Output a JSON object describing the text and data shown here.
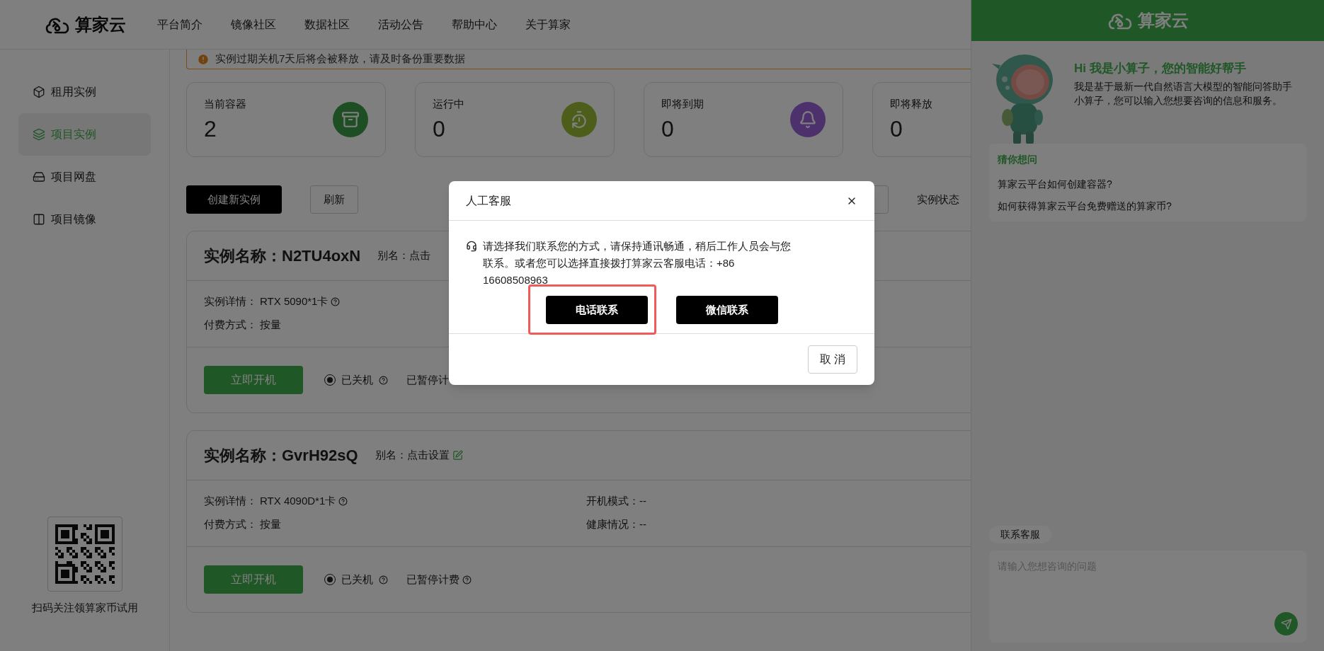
{
  "header": {
    "brand": "算家云",
    "nav": [
      {
        "label": "平台简介"
      },
      {
        "label": "镜像社区"
      },
      {
        "label": "数据社区"
      },
      {
        "label": "活动公告"
      },
      {
        "label": "帮助中心"
      },
      {
        "label": "关于算家"
      }
    ]
  },
  "sidebar": {
    "items": [
      {
        "label": "租用实例",
        "kind": "cube",
        "selected": false
      },
      {
        "label": "项目实例",
        "kind": "layers",
        "selected": true
      },
      {
        "label": "项目网盘",
        "kind": "disk",
        "selected": false
      },
      {
        "label": "项目镜像",
        "kind": "columns",
        "selected": false
      }
    ],
    "qr_caption": "扫码关注领算家币试用"
  },
  "notice": "实例过期关机7天后将会被释放，请及时备份重要数据",
  "stats": [
    {
      "label": "当前容器",
      "value": "2",
      "kind": "box"
    },
    {
      "label": "运行中",
      "value": "0",
      "kind": "timer"
    },
    {
      "label": "即将到期",
      "value": "0",
      "kind": "bell"
    },
    {
      "label": "即将释放",
      "value": "0",
      "kind": "none"
    }
  ],
  "toolbar": {
    "create_button": "创建新实例",
    "refresh_button": "刷新",
    "filter_label": "实例状态"
  },
  "instances": [
    {
      "title": "实例名称：N2TU4oxN",
      "alias": "别名：点击",
      "alias_edit": false,
      "details": [
        {
          "label": "实例详情：",
          "value": "RTX 5090*1卡",
          "help": true
        },
        {
          "label": "付费方式：",
          "value": "按量",
          "help": false
        }
      ],
      "start_button": "立即开机",
      "status": {
        "label": "已关机",
        "selected": true
      },
      "billing": "已暂停计",
      "billing_help": false
    },
    {
      "title": "实例名称：GvrH92sQ",
      "alias": "别名：点击设置",
      "alias_edit": true,
      "details": [
        {
          "label": "实例详情：",
          "value": "RTX 4090D*1卡",
          "help": true
        },
        {
          "label": "付费方式：",
          "value": "按量",
          "help": false
        }
      ],
      "details_right": [
        {
          "text": "开机模式：--"
        },
        {
          "text": "健康情况：--"
        }
      ],
      "start_button": "立即开机",
      "status": {
        "label": "已关机",
        "selected": true
      },
      "billing": "已暂停计费",
      "billing_help": true
    }
  ],
  "chat": {
    "brand": "算家云",
    "greeting_title": "Hi 我是小算子，您的智能好帮手",
    "greeting_text": "我是基于最新一代自然语言大模型的智能问答助手小算子，您可以输入您想要咨询的信息和服务。",
    "suggestions": {
      "title": "猜你想问",
      "items": [
        "算家云平台如何创建容器?",
        "如何获得算家云平台免费赠送的算家币?"
      ]
    },
    "contact_tag": "联系客服",
    "input": {
      "placeholder": "请输入您想咨询的问题"
    }
  },
  "dialog": {
    "title": "人工客服",
    "message": "请选择我们联系您的方式，请保持通讯畅通，稍后工作人员会与您联系。或者您可以选择直接拨打算家云客服电话：+86 16608508963",
    "buttons": [
      {
        "label": "电话联系",
        "highlighted": true
      },
      {
        "label": "微信联系",
        "highlighted": false
      }
    ],
    "cancel": "取 消"
  }
}
